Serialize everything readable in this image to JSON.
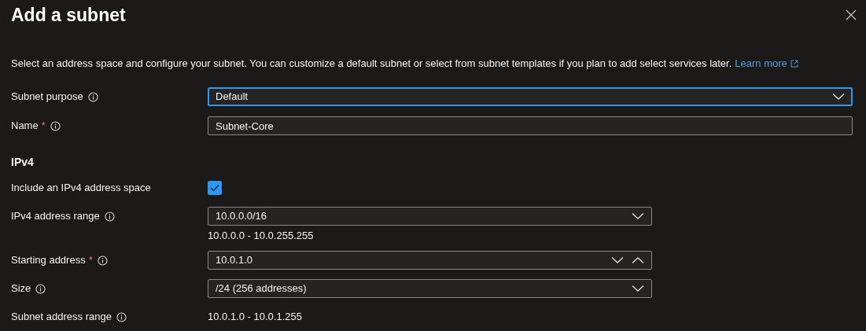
{
  "title": "Add a subnet",
  "description": {
    "text": "Select an address space and configure your subnet. You can customize a default subnet or select from subnet templates if you plan to add select services later.",
    "link": "Learn more"
  },
  "fields": [
    {
      "kind": "dropdown",
      "label": "Subnet purpose",
      "info": true,
      "value": "Default",
      "focused": true
    },
    {
      "kind": "text",
      "label": "Name",
      "required_mark": "*",
      "info": true,
      "value": "Subnet-Core",
      "focused": false
    }
  ],
  "ipv4": {
    "heading": "IPv4",
    "rows": [
      {
        "kind": "checkbox",
        "label": "Include an IPv4 address space",
        "info": false,
        "checked": true
      },
      {
        "kind": "dropdown",
        "label": "IPv4 address range",
        "info": true,
        "value": "10.0.0.0/16",
        "focused": false,
        "hint": "10.0.0.0 - 10.0.255.255"
      },
      {
        "kind": "spinner",
        "label": "Starting address",
        "required_mark": "*",
        "info": true,
        "value": "10.0.1.0",
        "focused": false
      },
      {
        "kind": "dropdown",
        "label": "Size",
        "info": true,
        "value": "/24 (256 addresses)",
        "focused": false
      },
      {
        "kind": "static",
        "label": "Subnet address range",
        "info": true,
        "value": "10.0.1.0 - 10.0.1.255"
      }
    ]
  }
}
